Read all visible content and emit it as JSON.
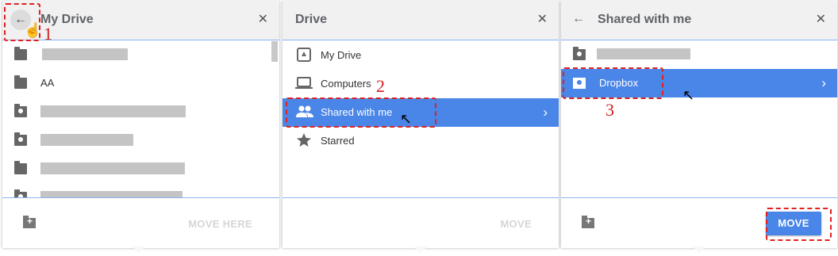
{
  "panel1": {
    "title": "My Drive",
    "back_icon": "arrow-left-icon",
    "close_icon": "close-icon",
    "items": [
      {
        "label": "",
        "icon": "folder-icon",
        "redacted": true
      },
      {
        "label": "AA",
        "icon": "folder-icon",
        "redacted": false
      },
      {
        "label": "",
        "icon": "shared-folder-icon",
        "redacted": true
      },
      {
        "label": "",
        "icon": "shared-folder-icon",
        "redacted": true
      },
      {
        "label": "",
        "icon": "folder-icon",
        "redacted": true
      },
      {
        "label": "",
        "icon": "shared-folder-icon",
        "redacted": true
      }
    ],
    "move_label": "MOVE HERE",
    "new_folder_icon": "new-folder-icon"
  },
  "panel2": {
    "title": "Drive",
    "close_icon": "close-icon",
    "items": [
      {
        "label": "My Drive",
        "icon": "drive-icon"
      },
      {
        "label": "Computers",
        "icon": "computer-icon"
      },
      {
        "label": "Shared with me",
        "icon": "people-icon",
        "selected": true
      },
      {
        "label": "Starred",
        "icon": "star-icon"
      }
    ],
    "move_label": "MOVE"
  },
  "panel3": {
    "title": "Shared with me",
    "back_icon": "arrow-left-icon",
    "close_icon": "close-icon",
    "items": [
      {
        "label": "",
        "icon": "shared-folder-icon",
        "redacted": true
      },
      {
        "label": "Dropbox",
        "icon": "shared-folder-icon",
        "selected": true
      }
    ],
    "move_label": "MOVE",
    "new_folder_icon": "new-folder-icon"
  },
  "annotations": {
    "step1": "1",
    "step2": "2",
    "step3": "3"
  },
  "colors": {
    "selection": "#4a86e8",
    "annotation": "#e02020",
    "header_bg": "#f1f1f1"
  }
}
